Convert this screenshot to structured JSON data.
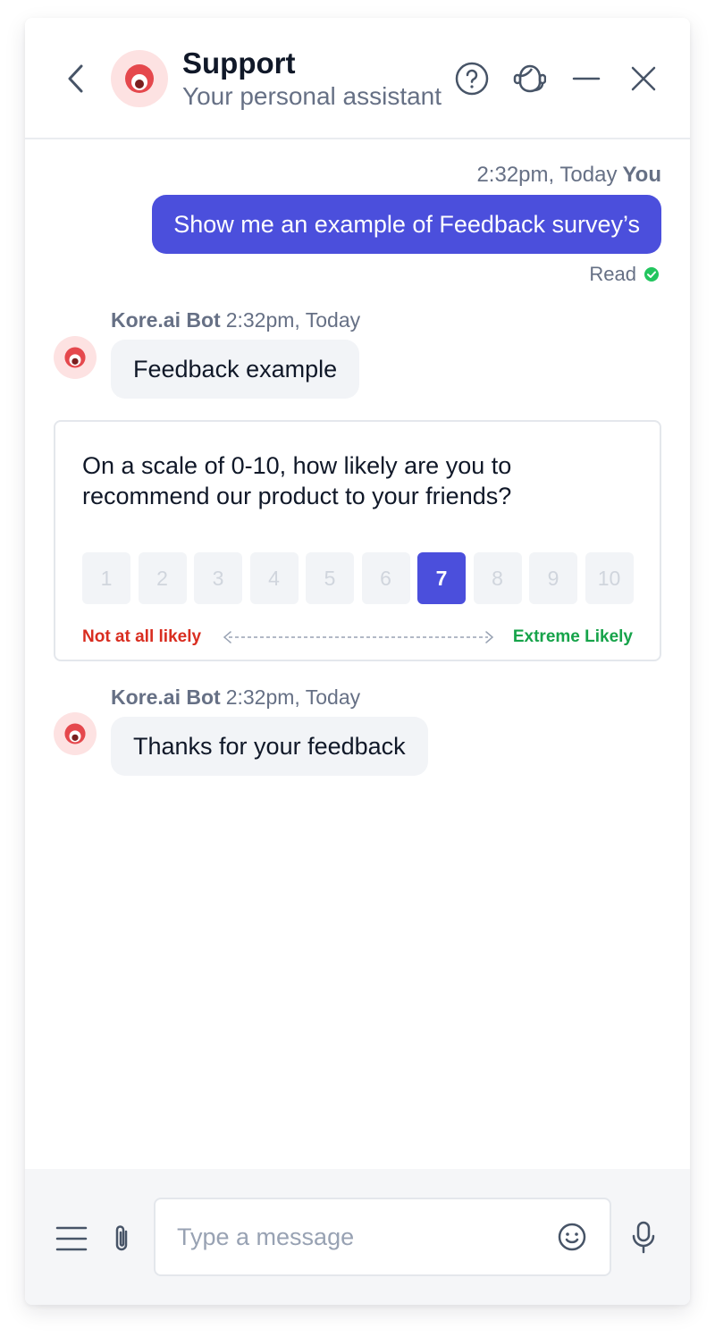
{
  "header": {
    "title": "Support",
    "subtitle": "Your personal assistant",
    "icons": [
      "chevron-left-icon",
      "help-circle-icon",
      "agent-headset-icon",
      "minimize-icon",
      "close-icon"
    ]
  },
  "messages": {
    "user": {
      "time": "2:32pm, Today",
      "sender": "You",
      "text": "Show me an example of Feedback survey’s",
      "status": "Read"
    },
    "bot1": {
      "sender": "Kore.ai Bot",
      "time": "2:32pm, Today",
      "text": "Feedback example"
    },
    "bot2": {
      "sender": "Kore.ai Bot",
      "time": "2:32pm, Today",
      "text": "Thanks for your feedback"
    }
  },
  "feedback": {
    "question": "On a scale of 0-10, how likely are you to recommend our product to your friends?",
    "scale": [
      "1",
      "2",
      "3",
      "4",
      "5",
      "6",
      "7",
      "8",
      "9",
      "10"
    ],
    "selected": "7",
    "low_label": "Not at all likely",
    "high_label": "Extreme Likely"
  },
  "composer": {
    "placeholder": "Type a message",
    "value": ""
  },
  "colors": {
    "accent": "#4b4fdc",
    "bot_brand": "#e5484d",
    "low": "#d92d20",
    "high": "#16a34a",
    "read": "#22c55e"
  }
}
